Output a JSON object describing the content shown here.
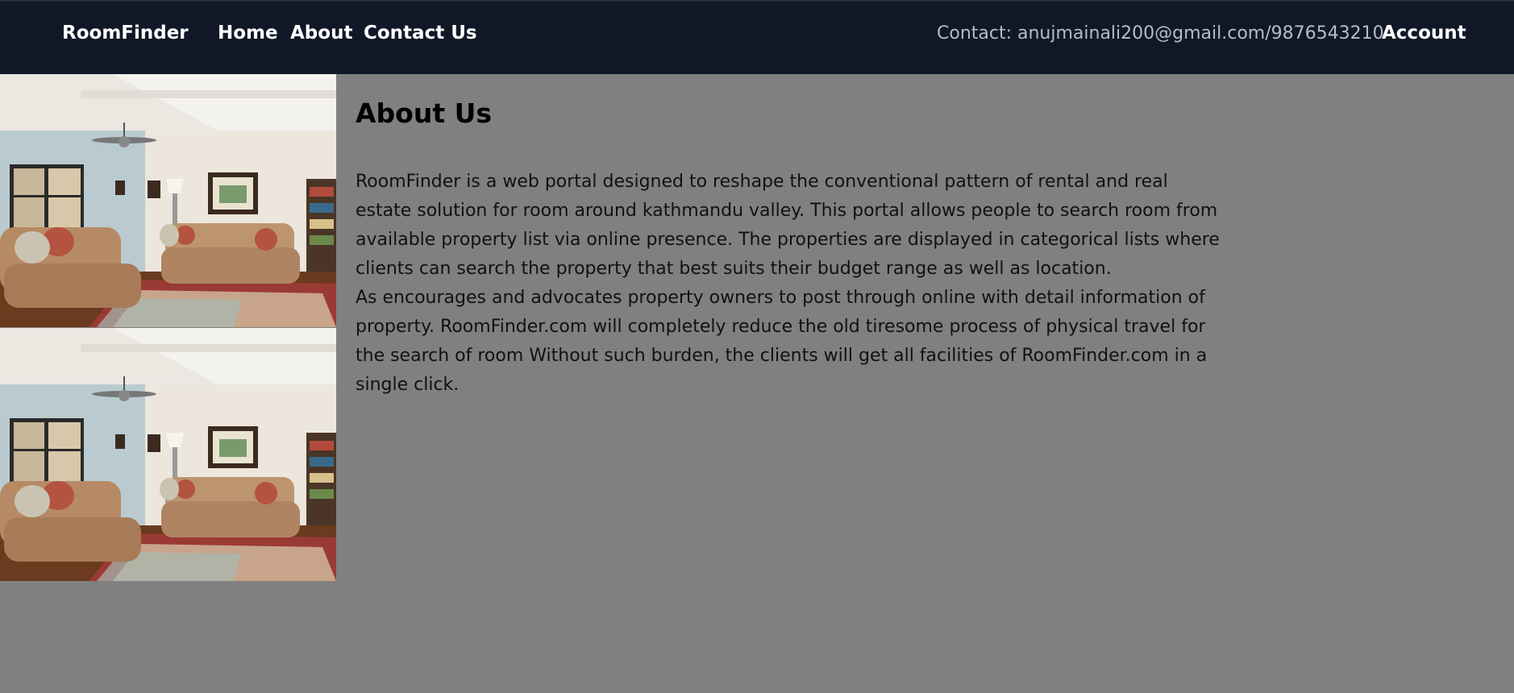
{
  "nav": {
    "brand": "RoomFinder",
    "links": [
      "Home",
      "About",
      "Contact Us"
    ],
    "contact_text": "Contact: anujmainali200@gmail.com/9876543210",
    "account": "Account"
  },
  "colors": {
    "navbar_bg": "#101828",
    "page_bg": "#808080",
    "nav_text": "#ffffff",
    "contact_text": "#b4bccb"
  },
  "main": {
    "heading": "About Us",
    "paragraphs": [
      "RoomFinder is a web portal designed to reshape the conventional pattern of rental and real estate solution for room around kathmandu valley. This portal allows people to search room from available property list via online presence. The properties are displayed in categorical lists where clients can search the property that best suits their budget range as well as location.",
      "As encourages and advocates property owners to post through online with detail information of property. RoomFinder.com will completely reduce the old tiresome process of physical travel for the search of room Without such burden, the clients will get all facilities of RoomFinder.com in a single click."
    ]
  },
  "images": [
    {
      "name": "living-room-photo"
    },
    {
      "name": "living-room-photo"
    }
  ]
}
